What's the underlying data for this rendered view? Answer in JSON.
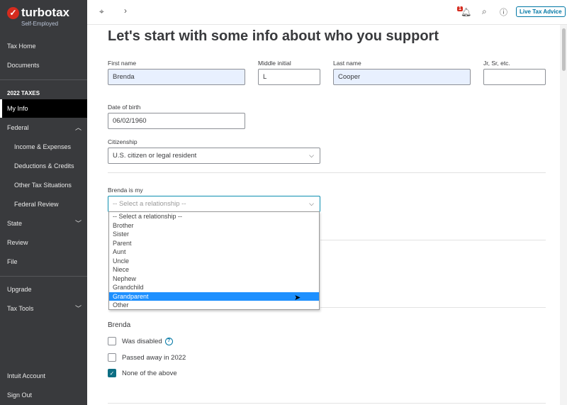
{
  "brand": {
    "name": "turbotax",
    "edition": "Self-Employed"
  },
  "sidebar": {
    "items": [
      "Tax Home",
      "Documents"
    ],
    "section": "2022 TAXES",
    "tax_items": [
      "My Info",
      "Federal",
      "Income & Expenses",
      "Deductions & Credits",
      "Other Tax Situations",
      "Federal Review",
      "State",
      "Review",
      "File"
    ],
    "bottom": [
      "Upgrade",
      "Tax Tools"
    ],
    "account": [
      "Intuit Account",
      "Sign Out"
    ]
  },
  "topbar": {
    "notifications": "1",
    "live_advice": "Live Tax Advice"
  },
  "title": "Let's start with some info about who you support",
  "form": {
    "first_name": {
      "label": "First name",
      "value": "Brenda"
    },
    "middle": {
      "label": "Middle initial",
      "value": "L"
    },
    "last_name": {
      "label": "Last name",
      "value": "Cooper"
    },
    "suffix": {
      "label": "Jr, Sr, etc.",
      "value": ""
    },
    "dob": {
      "label": "Date of birth",
      "value": "06/02/1960"
    },
    "citizenship": {
      "label": "Citizenship",
      "value": "U.S. citizen or legal resident"
    },
    "relationship": {
      "label": "Brenda is my",
      "value": "-- Select a relationship --",
      "options": [
        "-- Select a relationship --",
        "Brother",
        "Sister",
        "Parent",
        "Aunt",
        "Uncle",
        "Niece",
        "Nephew",
        "Grandchild",
        "Grandparent",
        "Other"
      ],
      "highlighted": "Grandparent"
    },
    "status": {
      "heading": "Brenda",
      "options": [
        {
          "label": "Was disabled",
          "checked": false
        },
        {
          "label": "Passed away in 2022",
          "checked": false
        },
        {
          "label": "None of the above",
          "checked": true
        }
      ]
    }
  },
  "colors": {
    "sidebar": "#393a3d",
    "accent": "#0077a5",
    "highlight": "#1e90ff",
    "brand_red": "#d52b1e"
  }
}
